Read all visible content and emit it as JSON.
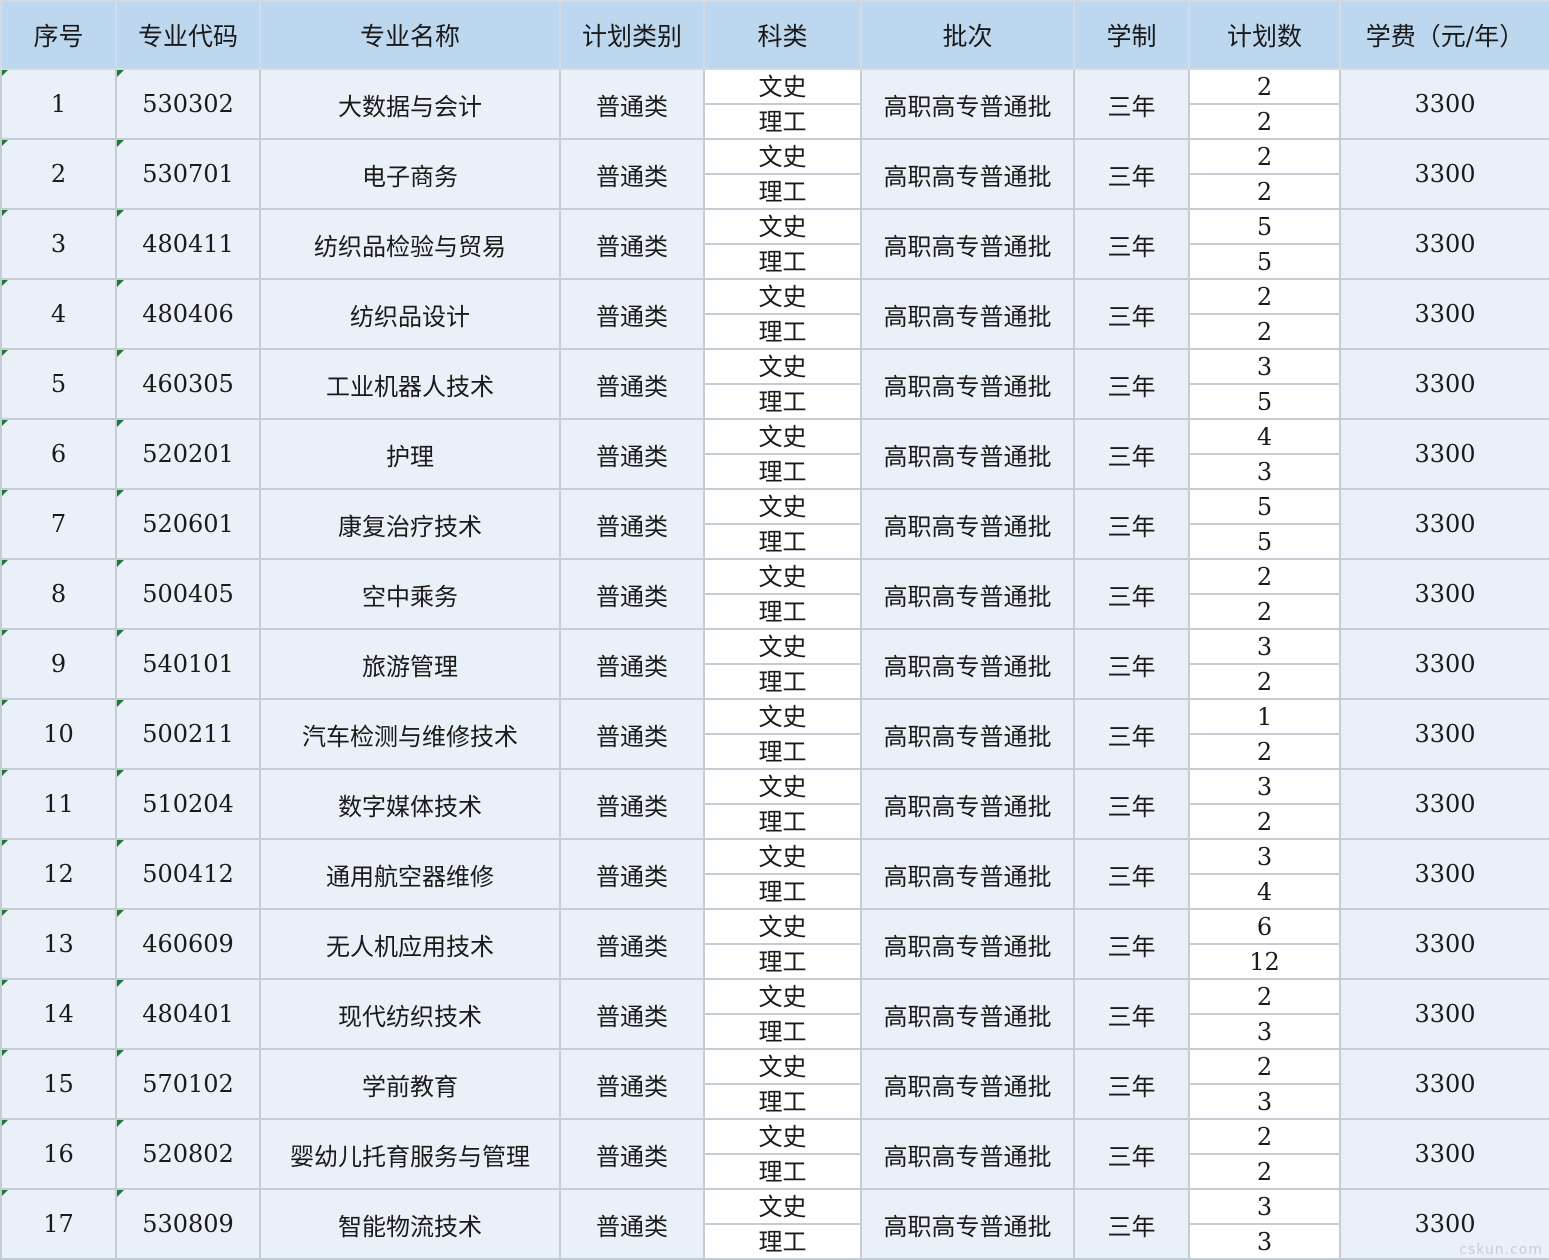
{
  "headers": [
    "序号",
    "专业代码",
    "专业名称",
    "计划类别",
    "科类",
    "批次",
    "学制",
    "计划数",
    "学费（元/年）"
  ],
  "rows": [
    {
      "seq": "1",
      "code": "530302",
      "name": "大数据与会计",
      "type": "普通类",
      "subjects": [
        "文史",
        "理工"
      ],
      "batch": "高职高专普通批",
      "years": "三年",
      "counts": [
        "2",
        "2"
      ],
      "fee": "3300"
    },
    {
      "seq": "2",
      "code": "530701",
      "name": "电子商务",
      "type": "普通类",
      "subjects": [
        "文史",
        "理工"
      ],
      "batch": "高职高专普通批",
      "years": "三年",
      "counts": [
        "2",
        "2"
      ],
      "fee": "3300"
    },
    {
      "seq": "3",
      "code": "480411",
      "name": "纺织品检验与贸易",
      "type": "普通类",
      "subjects": [
        "文史",
        "理工"
      ],
      "batch": "高职高专普通批",
      "years": "三年",
      "counts": [
        "5",
        "5"
      ],
      "fee": "3300"
    },
    {
      "seq": "4",
      "code": "480406",
      "name": "纺织品设计",
      "type": "普通类",
      "subjects": [
        "文史",
        "理工"
      ],
      "batch": "高职高专普通批",
      "years": "三年",
      "counts": [
        "2",
        "2"
      ],
      "fee": "3300"
    },
    {
      "seq": "5",
      "code": "460305",
      "name": "工业机器人技术",
      "type": "普通类",
      "subjects": [
        "文史",
        "理工"
      ],
      "batch": "高职高专普通批",
      "years": "三年",
      "counts": [
        "3",
        "5"
      ],
      "fee": "3300"
    },
    {
      "seq": "6",
      "code": "520201",
      "name": "护理",
      "type": "普通类",
      "subjects": [
        "文史",
        "理工"
      ],
      "batch": "高职高专普通批",
      "years": "三年",
      "counts": [
        "4",
        "3"
      ],
      "fee": "3300"
    },
    {
      "seq": "7",
      "code": "520601",
      "name": "康复治疗技术",
      "type": "普通类",
      "subjects": [
        "文史",
        "理工"
      ],
      "batch": "高职高专普通批",
      "years": "三年",
      "counts": [
        "5",
        "5"
      ],
      "fee": "3300"
    },
    {
      "seq": "8",
      "code": "500405",
      "name": "空中乘务",
      "type": "普通类",
      "subjects": [
        "文史",
        "理工"
      ],
      "batch": "高职高专普通批",
      "years": "三年",
      "counts": [
        "2",
        "2"
      ],
      "fee": "3300"
    },
    {
      "seq": "9",
      "code": "540101",
      "name": "旅游管理",
      "type": "普通类",
      "subjects": [
        "文史",
        "理工"
      ],
      "batch": "高职高专普通批",
      "years": "三年",
      "counts": [
        "3",
        "2"
      ],
      "fee": "3300"
    },
    {
      "seq": "10",
      "code": "500211",
      "name": "汽车检测与维修技术",
      "type": "普通类",
      "subjects": [
        "文史",
        "理工"
      ],
      "batch": "高职高专普通批",
      "years": "三年",
      "counts": [
        "1",
        "2"
      ],
      "fee": "3300"
    },
    {
      "seq": "11",
      "code": "510204",
      "name": "数字媒体技术",
      "type": "普通类",
      "subjects": [
        "文史",
        "理工"
      ],
      "batch": "高职高专普通批",
      "years": "三年",
      "counts": [
        "3",
        "2"
      ],
      "fee": "3300"
    },
    {
      "seq": "12",
      "code": "500412",
      "name": "通用航空器维修",
      "type": "普通类",
      "subjects": [
        "文史",
        "理工"
      ],
      "batch": "高职高专普通批",
      "years": "三年",
      "counts": [
        "3",
        "4"
      ],
      "fee": "3300"
    },
    {
      "seq": "13",
      "code": "460609",
      "name": "无人机应用技术",
      "type": "普通类",
      "subjects": [
        "文史",
        "理工"
      ],
      "batch": "高职高专普通批",
      "years": "三年",
      "counts": [
        "6",
        "12"
      ],
      "fee": "3300"
    },
    {
      "seq": "14",
      "code": "480401",
      "name": "现代纺织技术",
      "type": "普通类",
      "subjects": [
        "文史",
        "理工"
      ],
      "batch": "高职高专普通批",
      "years": "三年",
      "counts": [
        "2",
        "3"
      ],
      "fee": "3300"
    },
    {
      "seq": "15",
      "code": "570102",
      "name": "学前教育",
      "type": "普通类",
      "subjects": [
        "文史",
        "理工"
      ],
      "batch": "高职高专普通批",
      "years": "三年",
      "counts": [
        "2",
        "3"
      ],
      "fee": "3300"
    },
    {
      "seq": "16",
      "code": "520802",
      "name": "婴幼儿托育服务与管理",
      "type": "普通类",
      "subjects": [
        "文史",
        "理工"
      ],
      "batch": "高职高专普通批",
      "years": "三年",
      "counts": [
        "2",
        "2"
      ],
      "fee": "3300"
    },
    {
      "seq": "17",
      "code": "530809",
      "name": "智能物流技术",
      "type": "普通类",
      "subjects": [
        "文史",
        "理工"
      ],
      "batch": "高职高专普通批",
      "years": "三年",
      "counts": [
        "3",
        "3"
      ],
      "fee": "3300"
    }
  ],
  "watermark": "cskun.com"
}
